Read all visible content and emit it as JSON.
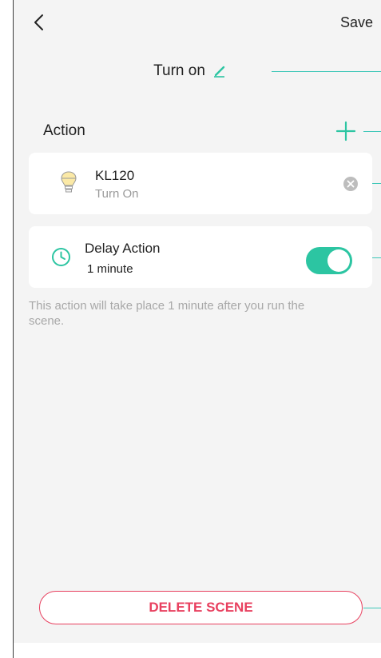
{
  "header": {
    "back_icon": "chevron-left-icon",
    "save_label": "Save"
  },
  "scene": {
    "title": "Turn on",
    "edit_icon": "pencil-icon"
  },
  "action_section": {
    "label": "Action",
    "add_icon": "plus-icon"
  },
  "actions": [
    {
      "device": "KL120",
      "state": "Turn On",
      "icon": "bulb-icon",
      "remove_icon": "close-circle-icon"
    }
  ],
  "delay": {
    "label": "Delay Action",
    "value": "1 minute",
    "icon": "clock-icon",
    "enabled": true
  },
  "note": "This action will take place 1 minute after you run the scene.",
  "delete_label": "DELETE SCENE",
  "colors": {
    "accent": "#2cc5a2",
    "danger": "#e8405f",
    "callout": "#3ec7b8",
    "background": "#f4f4f4"
  }
}
